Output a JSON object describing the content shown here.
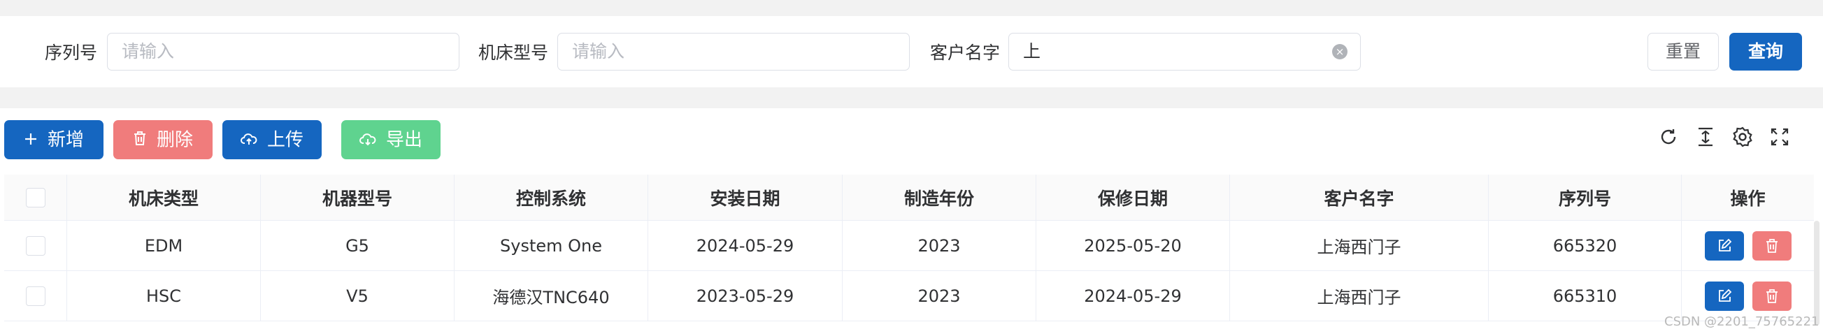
{
  "search": {
    "serial_label": "序列号",
    "serial_placeholder": "请输入",
    "model_label": "机床型号",
    "model_placeholder": "请输入",
    "customer_label": "客户名字",
    "customer_value": "上",
    "reset_label": "重置",
    "query_label": "查询"
  },
  "toolbar": {
    "add_label": "新增",
    "delete_label": "删除",
    "upload_label": "上传",
    "export_label": "导出",
    "icons": [
      "refresh-icon",
      "density-icon",
      "settings-icon",
      "fullscreen-icon"
    ]
  },
  "table": {
    "columns": [
      "机床类型",
      "机器型号",
      "控制系统",
      "安装日期",
      "制造年份",
      "保修日期",
      "客户名字",
      "序列号",
      "操作"
    ],
    "rows": [
      [
        "EDM",
        "G5",
        "System One",
        "2024-05-29",
        "2023",
        "2025-05-20",
        "上海西门子",
        "665320"
      ],
      [
        "HSC",
        "V5",
        "海德汉TNC640",
        "2023-05-29",
        "2023",
        "2024-05-29",
        "上海西门子",
        "665310"
      ]
    ]
  },
  "watermark": "CSDN @2201_75765221",
  "colors": {
    "primary": "#1566c0",
    "danger": "#f07c7c",
    "success": "#5fd38f"
  }
}
